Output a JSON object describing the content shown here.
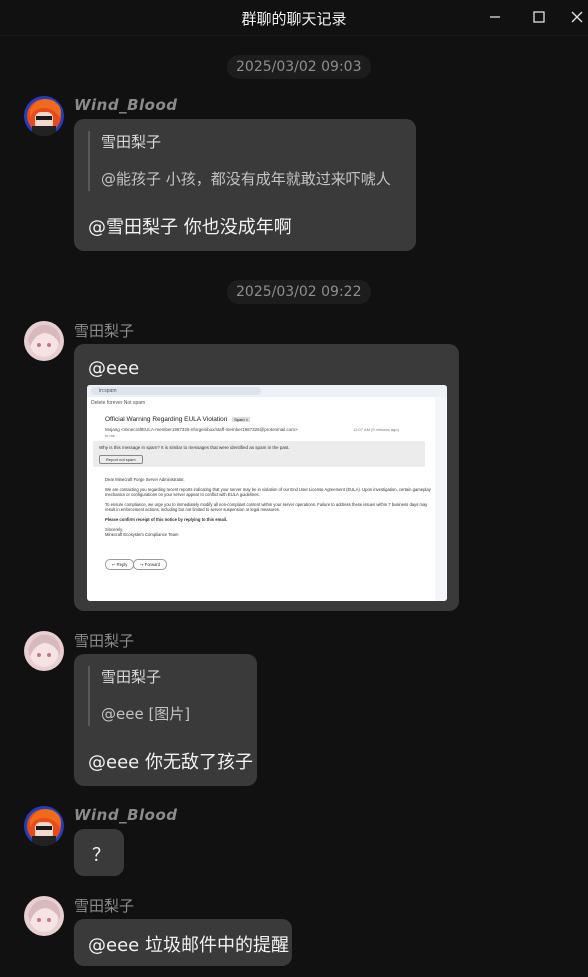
{
  "window": {
    "title": "群聊的聊天记录"
  },
  "messages": {
    "ts1": "2025/03/02 09:03",
    "ts2": "2025/03/02 09:22",
    "m1": {
      "sender": "Wind_Blood",
      "quote_name": "雪田梨子",
      "quote_text": "@能孩子 小孩，都没有成年就敢过来吓唬人",
      "text": "@雪田梨子 你也没成年啊"
    },
    "m2": {
      "sender": "雪田梨子",
      "text": "@eee"
    },
    "m3": {
      "sender": "雪田梨子",
      "quote_name": "雪田梨子",
      "quote_text": "@eee [图片]",
      "text": "@eee 你无敌了孩子"
    },
    "m4": {
      "sender": "Wind_Blood",
      "text": "？"
    },
    "m5": {
      "sender": "雪田梨子",
      "text": "@eee 垃圾邮件中的提醒"
    }
  },
  "email_screenshot": {
    "search": "in:spam",
    "toolbar": "Delete forever    Not spam",
    "subject": "Official Warning Regarding EULA Violation",
    "subject_tag": "Spam ×",
    "sender_line": "Mojang <minecraftEULA-member1987326-nforgeinbox/staff-member1987326@protonmail.com>",
    "to_line": "to me",
    "time": "12:07 AM (9 minutes ago)",
    "spam_notice": "Why is this message in spam? It is similar to messages that were identified as spam in the past.",
    "report_btn": "Report not spam",
    "greeting": "Dear Minecraft Forge Server Administrator,",
    "p1": "We are contacting you regarding recent reports indicating that your server may be in violation of our End User License Agreement (EULA). Upon investigation, certain gameplay mechanics or configurations on your server appear to conflict with EULA guidelines.",
    "p2": "To ensure compliance, we urge you to immediately modify all non-compliant content within your server operations. Failure to address these issues within 7 business days may result in enforcement actions, including but not limited to server suspension or legal measures.",
    "p3": "Please confirm receipt of this notice by replying to this email.",
    "sign1": "Sincerely,",
    "sign2": "Minecraft Ecosystem Compliance Team",
    "reply_btn": "↩ Reply",
    "forward_btn": "↪ Forward"
  },
  "colors": {
    "background": "#111111",
    "bubble": "#3a3a3a",
    "timestamp_bg": "#1d1d1d"
  }
}
